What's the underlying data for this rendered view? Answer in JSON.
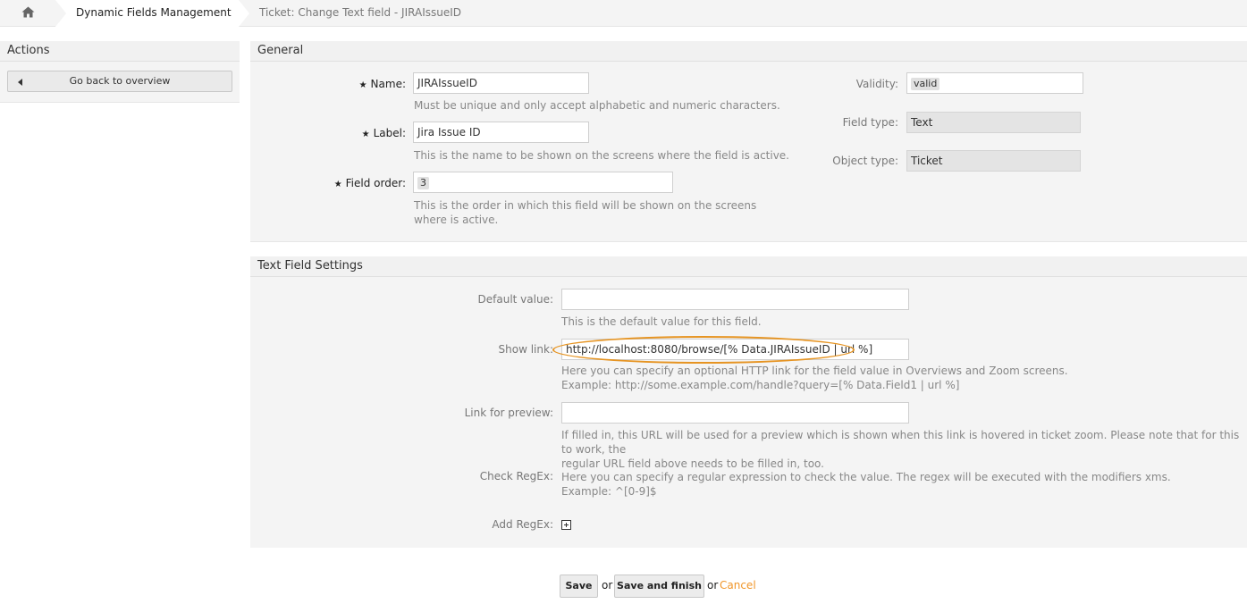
{
  "breadcrumb": {
    "home_icon": "home-icon",
    "section": "Dynamic Fields Management",
    "current": "Ticket: Change Text field - JIRAIssueID"
  },
  "sidebar": {
    "title": "Actions",
    "back_button": "Go back to overview"
  },
  "general": {
    "title": "General",
    "name": {
      "label": "Name:",
      "value": "JIRAIssueID",
      "hint": "Must be unique and only accept alphabetic and numeric characters."
    },
    "label": {
      "label": "Label:",
      "value": "Jira Issue ID",
      "hint": "This is the name to be shown on the screens where the field is active."
    },
    "field_order": {
      "label": "Field order:",
      "value": "3",
      "hint_line1": "This is the order in which this field will be shown on the screens",
      "hint_line2": "where is active."
    },
    "validity": {
      "label": "Validity:",
      "value": "valid"
    },
    "field_type": {
      "label": "Field type:",
      "value": "Text"
    },
    "object_type": {
      "label": "Object type:",
      "value": "Ticket"
    }
  },
  "text_settings": {
    "title": "Text Field Settings",
    "default_value": {
      "label": "Default value:",
      "value": "",
      "hint": "This is the default value for this field."
    },
    "show_link": {
      "label": "Show link:",
      "value": "http://localhost:8080/browse/[% Data.JIRAIssueID | url %]",
      "hint_line1": "Here you can specify an optional HTTP link for the field value in Overviews and Zoom screens.",
      "hint_line2": "Example: http://some.example.com/handle?query=[% Data.Field1 | url %]"
    },
    "link_preview": {
      "label": "Link for preview:",
      "value": "",
      "hint_line1": "If filled in, this URL will be used for a preview which is shown when this link is hovered in ticket zoom. Please note that for this to work, the",
      "hint_line2": "regular URL field above needs to be filled in, too."
    },
    "check_regex": {
      "label": "Check RegEx:",
      "hint_line1": "Here you can specify a regular expression to check the value. The regex will be executed with the modifiers xms.",
      "hint_line2": "Example: ^[0-9]$"
    },
    "add_regex": {
      "label": "Add RegEx:",
      "icon": "plus-square-icon"
    }
  },
  "footer": {
    "save": "Save",
    "or1": "or",
    "save_finish": "Save and finish",
    "or2": "or",
    "cancel": "Cancel"
  },
  "colors": {
    "accent": "#f0962a",
    "highlight": "#e69422",
    "panel_bg": "#f4f4f4"
  }
}
